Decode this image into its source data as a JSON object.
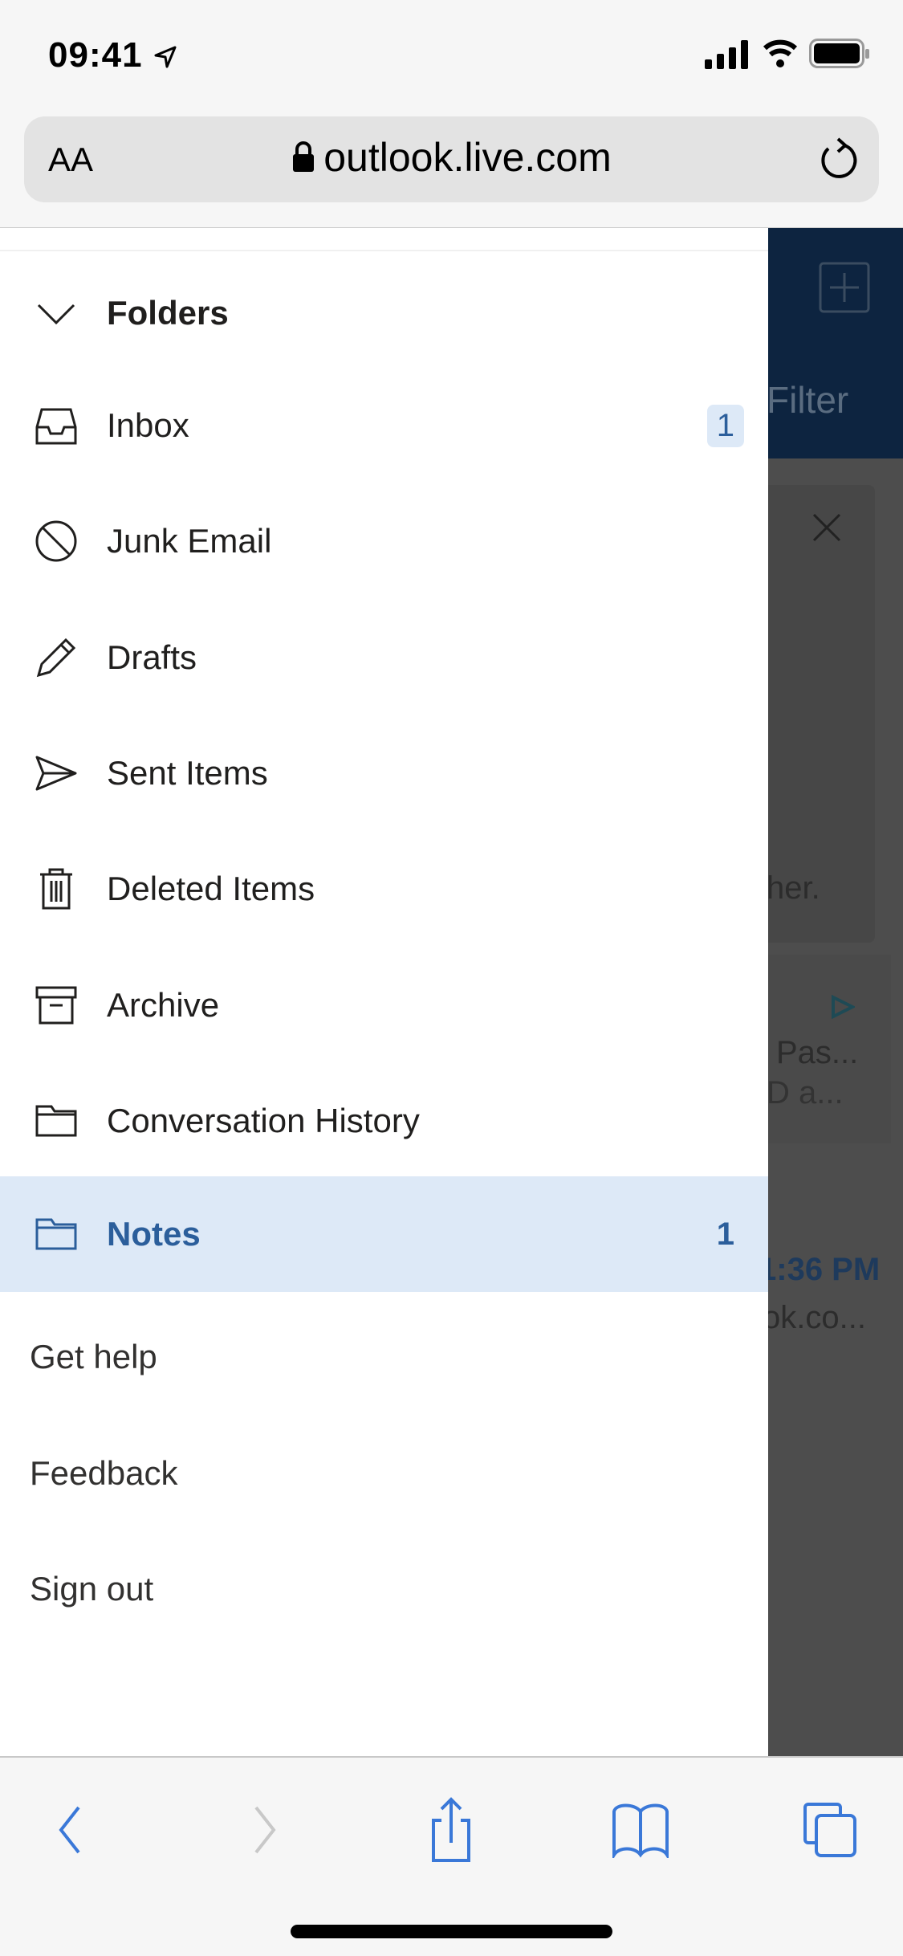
{
  "status_bar": {
    "time": "09:41"
  },
  "browser": {
    "text_size_label": "AA",
    "url": "outlook.live.com"
  },
  "background": {
    "filter_label": "Filter",
    "snippet1": "her.",
    "snippet2": "Pas...",
    "snippet3": "D a...",
    "time": "1:36 PM",
    "snippet4": "ok.co..."
  },
  "drawer": {
    "section_title": "Folders",
    "folders": [
      {
        "label": "Inbox",
        "icon": "inbox-icon",
        "count": "1"
      },
      {
        "label": "Junk Email",
        "icon": "block-icon"
      },
      {
        "label": "Drafts",
        "icon": "pencil-icon"
      },
      {
        "label": "Sent Items",
        "icon": "send-icon"
      },
      {
        "label": "Deleted Items",
        "icon": "trash-icon"
      },
      {
        "label": "Archive",
        "icon": "archive-icon"
      },
      {
        "label": "Conversation History",
        "icon": "folder-icon"
      },
      {
        "label": "Notes",
        "icon": "folder-icon",
        "count": "1",
        "selected": true
      }
    ],
    "links": [
      "Get help",
      "Feedback",
      "Sign out"
    ]
  },
  "colors": {
    "accent": "#2b5e9b",
    "selected_bg": "#dde9f7",
    "header": "#0d2440",
    "safari_blue": "#3a78d8"
  }
}
